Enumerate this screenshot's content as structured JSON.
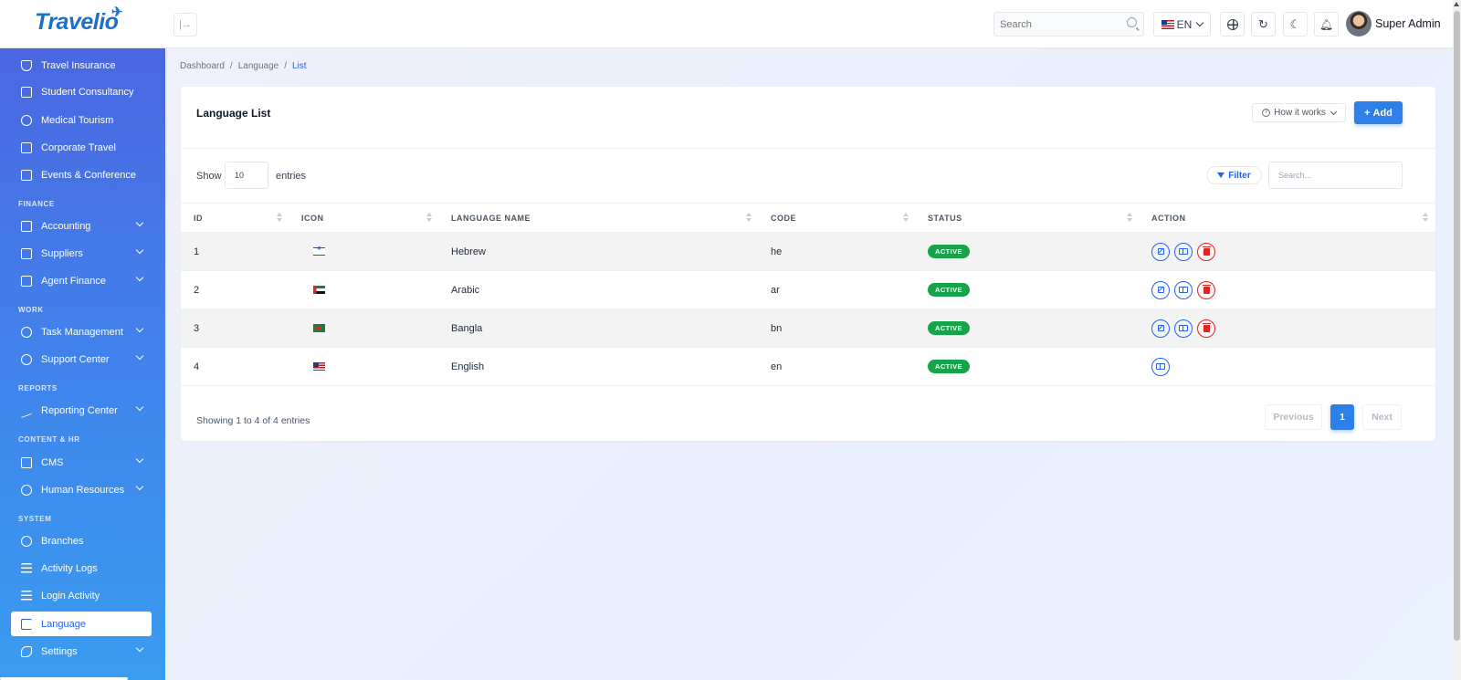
{
  "header": {
    "logo_text": "Travelio",
    "search_placeholder": "Search",
    "language_code": "EN",
    "user_name": "Super Admin"
  },
  "sidebar": {
    "items": [
      {
        "label": "Travel Insurance",
        "icon": "shield-icon"
      },
      {
        "label": "Student Consultancy",
        "icon": "graduation-cap-icon"
      },
      {
        "label": "Medical Tourism",
        "icon": "heart-icon"
      },
      {
        "label": "Corporate Travel",
        "icon": "briefcase-icon"
      },
      {
        "label": "Events & Conference",
        "icon": "calendar-icon"
      },
      {
        "label": "Accounting",
        "icon": "calculator-icon"
      },
      {
        "label": "Suppliers",
        "icon": "briefcase-icon"
      },
      {
        "label": "Agent Finance",
        "icon": "folder-icon"
      },
      {
        "label": "Task Management",
        "icon": "check-circle-icon"
      },
      {
        "label": "Support Center",
        "icon": "lifebuoy-icon"
      },
      {
        "label": "Reporting Center",
        "icon": "trend-line-icon"
      },
      {
        "label": "CMS",
        "icon": "monitor-icon"
      },
      {
        "label": "Human Resources",
        "icon": "users-icon"
      },
      {
        "label": "Branches",
        "icon": "map-pin-icon"
      },
      {
        "label": "Activity Logs",
        "icon": "list-icon"
      },
      {
        "label": "Login Activity",
        "icon": "list-icon"
      },
      {
        "label": "Language",
        "icon": "flag-icon"
      },
      {
        "label": "Settings",
        "icon": "wrench-icon"
      }
    ],
    "sections": {
      "finance": "FINANCE",
      "work": "WORK",
      "reports": "REPORTS",
      "content_hr": "CONTENT & HR",
      "system": "SYSTEM"
    }
  },
  "breadcrumb": {
    "items": [
      "Dashboard",
      "Language",
      "List"
    ],
    "separator": "/"
  },
  "card": {
    "title": "Language List",
    "how_it_works": "How it works",
    "add_label": "Add",
    "show_label": "Show",
    "page_size": "10",
    "entries_label": "entries",
    "filter_label": "Filter",
    "search_placeholder": "Search..."
  },
  "table": {
    "columns": [
      "ID",
      "ICON",
      "LANGUAGE NAME",
      "CODE",
      "STATUS",
      "ACTION"
    ],
    "rows": [
      {
        "id": "1",
        "flag": "israel-flag",
        "name": "Hebrew",
        "code": "he",
        "status": "ACTIVE"
      },
      {
        "id": "2",
        "flag": "uae-flag",
        "name": "Arabic",
        "code": "ar",
        "status": "ACTIVE"
      },
      {
        "id": "3",
        "flag": "bangladesh-flag",
        "name": "Bangla",
        "code": "bn",
        "status": "ACTIVE"
      },
      {
        "id": "4",
        "flag": "us-flag",
        "name": "English",
        "code": "en",
        "status": "ACTIVE"
      }
    ]
  },
  "pagination": {
    "summary": "Showing 1 to 4 of 4 entries",
    "previous": "Previous",
    "current_page": "1",
    "next": "Next"
  },
  "colors": {
    "primary": "#2f7fe8",
    "sidebar_top": "#4b67e0",
    "sidebar_bottom": "#3a9cf0",
    "status_active": "#16a34a",
    "delete": "#dc2626"
  }
}
